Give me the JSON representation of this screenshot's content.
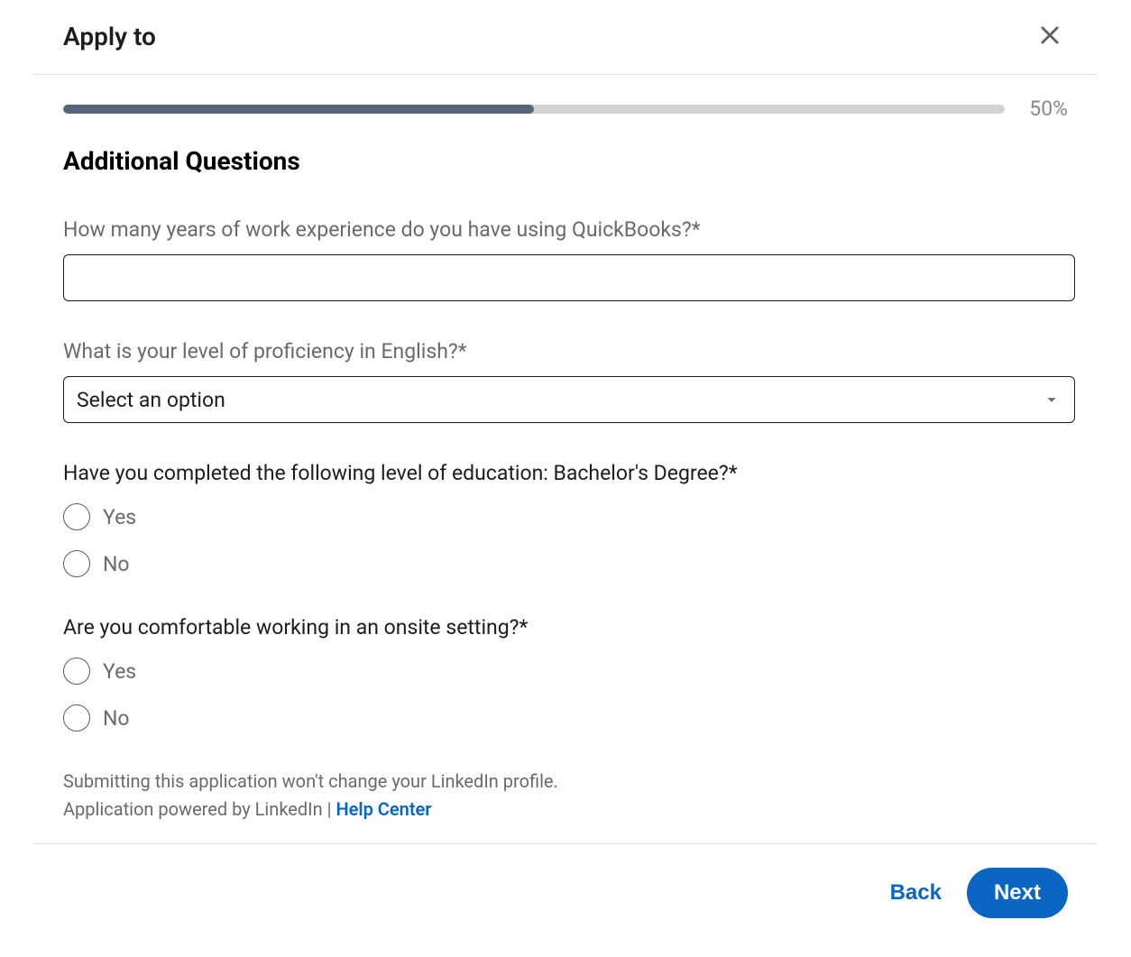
{
  "header": {
    "title": "Apply to",
    "close_aria": "close"
  },
  "progress": {
    "percent_label": "50%",
    "percent_value": 50
  },
  "main": {
    "heading": "Additional Questions",
    "q1": {
      "label": "How many years of work experience do you have using QuickBooks?*",
      "value": ""
    },
    "q2": {
      "label": "What is your level of proficiency in English?*",
      "placeholder": "Select an option"
    },
    "q3": {
      "label": "Have you completed the following level of education: Bachelor's Degree?*",
      "options": {
        "yes": "Yes",
        "no": "No"
      }
    },
    "q4": {
      "label": "Are you comfortable working in an onsite setting?*",
      "options": {
        "yes": "Yes",
        "no": "No"
      }
    }
  },
  "disclaimer": {
    "line1": "Submitting this application won't change your LinkedIn profile.",
    "line2_prefix": "Application powered by LinkedIn",
    "separator": " | ",
    "help_link": "Help Center"
  },
  "footer": {
    "back_label": "Back",
    "next_label": "Next"
  }
}
